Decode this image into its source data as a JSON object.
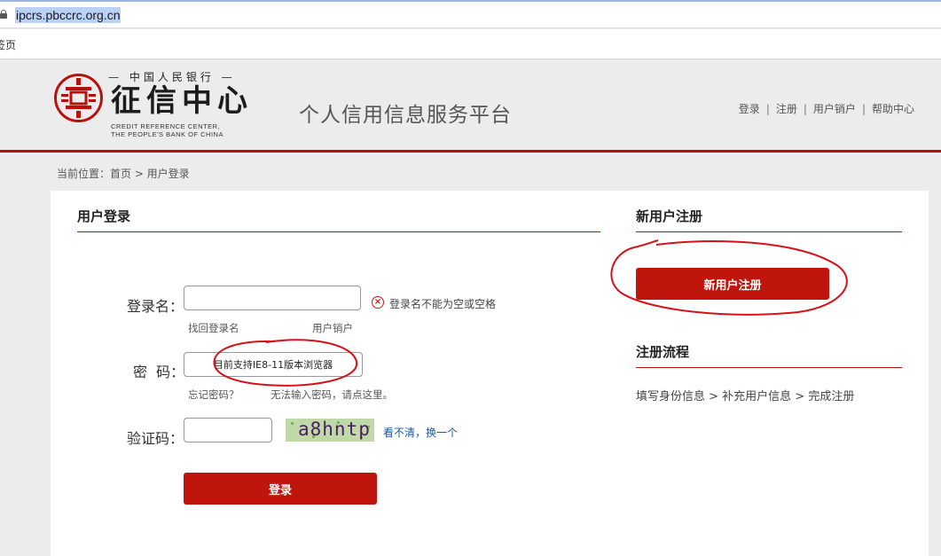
{
  "browser": {
    "url": "ipcrs.pbccrc.org.cn",
    "bookmark": "签页"
  },
  "header": {
    "logo_top": "中国人民银行",
    "logo_main": "征信中心",
    "logo_en_line1": "CREDIT REFERENCE CENTER,",
    "logo_en_line2": "THE PEOPLE'S BANK OF CHINA",
    "platform_title": "个人信用信息服务平台",
    "nav": {
      "login": "登录",
      "register": "注册",
      "cancel_account": "用户销户",
      "help": "帮助中心"
    }
  },
  "breadcrumb": "当前位置：首页 > 用户登录",
  "login": {
    "title": "用户登录",
    "username_label": "登录名：",
    "username_value": "",
    "username_error": "登录名不能为空或空格",
    "find_username": "找回登录名",
    "cancel_account": "用户销户",
    "password_label": "密  码：",
    "password_value": "目前支持IE8-11版本浏览器",
    "forgot_password": "忘记密码？",
    "cannot_input": "无法输入密码，请点这里。",
    "captcha_label": "验证码：",
    "captcha_value": "",
    "captcha_text": "a8hntp",
    "refresh_captcha": "看不清，换一个",
    "submit": "登录"
  },
  "register": {
    "title": "新用户注册",
    "button": "新用户注册",
    "flow_title": "注册流程",
    "flow_text": "填写身份信息 > 补充用户信息 > 完成注册"
  },
  "colors": {
    "brand_red": "#c0150d",
    "annotation_red": "#d8101a"
  }
}
